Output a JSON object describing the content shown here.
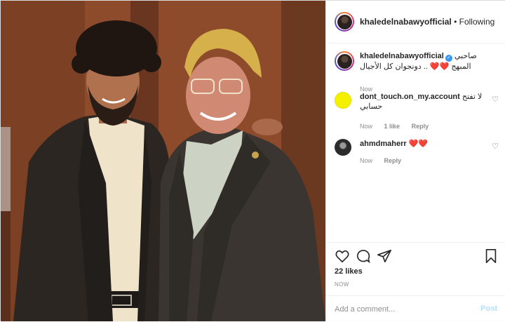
{
  "header": {
    "username": "khaledelnabawyofficial",
    "separator": "•",
    "follow_status": "Following"
  },
  "photo": {
    "description_icon": "photo"
  },
  "caption": {
    "username": "khaledelnabawyofficial",
    "verified_mark": "✓",
    "text": "صاحبي المبهج ❤️❤️ .. دونجوان كل الأجيال",
    "time": "Now"
  },
  "comments": [
    {
      "username": "dont_touch.on_my.account",
      "text": "لا تفتح حسابي",
      "time": "Now",
      "likes": "1 like",
      "reply": "Reply"
    },
    {
      "username": "ahmdmaherr",
      "text": "❤️❤️",
      "time": "Now",
      "reply": "Reply"
    }
  ],
  "actions": {
    "likes": "22 likes",
    "date": "NOW"
  },
  "add_comment": {
    "placeholder": "Add a comment...",
    "post_label": "Post"
  },
  "colors": {
    "link": "#3897f0",
    "post_disabled": "#b2dffc",
    "text": "#262626",
    "muted": "#8e8e8e"
  }
}
